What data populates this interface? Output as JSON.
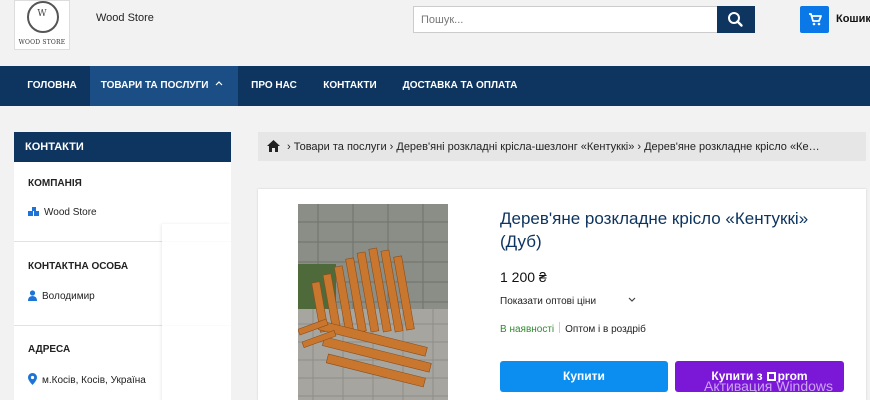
{
  "header": {
    "logo": {
      "monogram": "W",
      "text": "WOOD STORE"
    },
    "store_name": "Wood Store",
    "search": {
      "placeholder": "Пошук..."
    },
    "cart_label": "Кошик"
  },
  "nav": {
    "items": [
      {
        "label": "ГОЛОВНА"
      },
      {
        "label": "ТОВАРИ ТА ПОСЛУГИ",
        "icon": "chevron-up-icon",
        "active": true
      },
      {
        "label": "ПРО НАС"
      },
      {
        "label": "КОНТАКТИ"
      },
      {
        "label": "ДОСТАВКА ТА ОПЛАТА"
      }
    ]
  },
  "sidebar": {
    "title": "КОНТАКТИ",
    "company_heading": "КОМПАНІЯ",
    "company_name": "Wood Store",
    "contact_heading": "КОНТАКТНА ОСОБА",
    "contact_name": "Володимир",
    "address_heading": "АДРЕСА",
    "address": "м.Косів, Косів, Україна"
  },
  "breadcrumbs": {
    "trail": "› Товари та послуги › Дерев'яні розкладні крісла-шезлонг «Кентуккі» › Дерев'яне розкладне крісло «Ке…"
  },
  "product": {
    "title": "Дерев'яне розкладне крісло «Кентуккі» (Дуб)",
    "price": "1 200 ₴",
    "wholesale_toggle": "Показати оптові ціни",
    "stock_status": "В наявності",
    "sale_type": "Оптом і в роздріб",
    "buy_button": "Купити",
    "buy_prom_prefix": "Купити з",
    "buy_prom_brand": "prom"
  },
  "overlay": {
    "watermark": "Активация Windows"
  },
  "colors": {
    "nav_bg": "#0e3560",
    "nav_active": "#1a4e85",
    "accent_blue": "#0b8ef0",
    "prom_purple": "#7b18d8",
    "in_stock_green": "#2f8a2f"
  }
}
